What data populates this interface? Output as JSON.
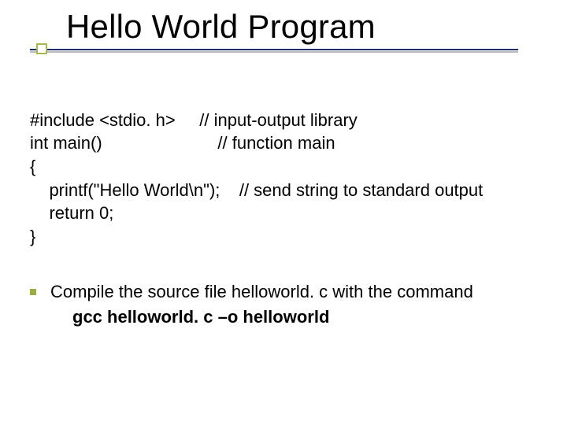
{
  "title": "Hello World Program",
  "code": {
    "l1": "#include <stdio. h>     // input-output library",
    "l2": "int main()                        // function main",
    "l3": "{",
    "l4": "    printf(\"Hello World\\n\");    // send string to standard output",
    "l5": "    return 0;",
    "l6": "}"
  },
  "bullet1": "Compile the source file helloworld. c with the command",
  "bullet1_sub": "gcc helloworld. c –o helloworld"
}
